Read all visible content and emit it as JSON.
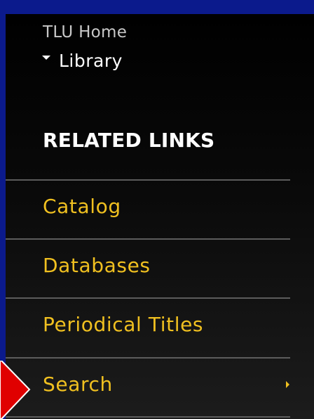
{
  "breadcrumb": {
    "home_label": "TLU Home",
    "current_label": "Library"
  },
  "related_links": {
    "heading": "RELATED LINKS",
    "items": [
      {
        "label": "Catalog",
        "has_submenu": false
      },
      {
        "label": "Databases",
        "has_submenu": false
      },
      {
        "label": "Periodical Titles",
        "has_submenu": false
      },
      {
        "label": "Search",
        "has_submenu": true
      }
    ]
  },
  "colors": {
    "page_background": "#0b1a8c",
    "panel_background": "#000000",
    "link_color": "#f0c020",
    "heading_color": "#ffffff",
    "pointer_arrow": "#e00000"
  },
  "icons": {
    "current_marker": "caret-down-icon",
    "submenu_indicator": "caret-right-icon",
    "highlight_pointer": "red-arrow-icon"
  }
}
